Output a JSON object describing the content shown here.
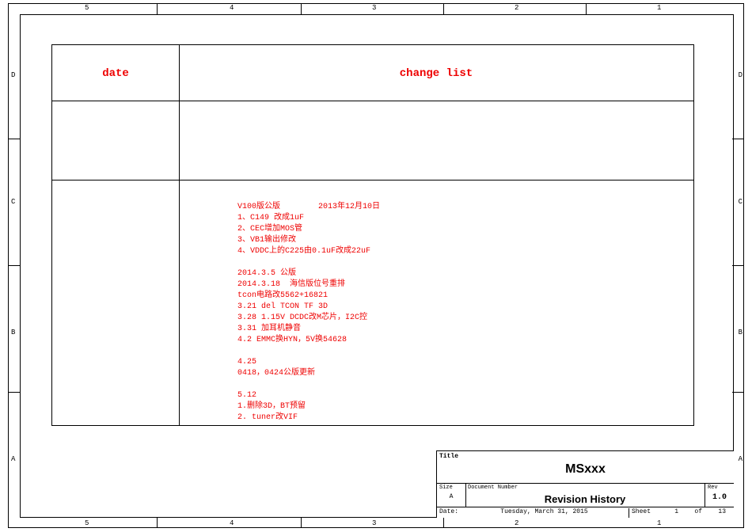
{
  "frame": {
    "top_numbers": [
      "5",
      "4",
      "3",
      "2",
      "1"
    ],
    "bottom_numbers": [
      "5",
      "4",
      "3",
      "2",
      "1"
    ],
    "left_letters": [
      "D",
      "C",
      "B",
      "A"
    ],
    "right_letters": [
      "D",
      "C",
      "B",
      "A"
    ]
  },
  "rev_table": {
    "header_date": "date",
    "header_change": "change list"
  },
  "notes": {
    "block1_header": "V100版公版        2013年12月10日",
    "block1_l1": "1、C149 改成1uF",
    "block1_l2": "2、CEC增加MOS管",
    "block1_l3": "3、VB1输出修改",
    "block1_l4": "4、VDDC上的C225由0.1uF改成22uF",
    "block2_l1": "2014.3.5 公版",
    "block2_l2": "2014.3.18  海信版位号重排",
    "block2_l3": "tcon电路改5562+16821",
    "block2_l4": "3.21 del TCON TF 3D",
    "block2_l5": "3.28 1.15V DCDC改M芯片，I2C控",
    "block2_l6": "3.31 加耳机静音",
    "block2_l7": "4.2 EMMC换HYN，5V换54628",
    "block3_l1": "4.25",
    "block3_l2": "0418，0424公版更新",
    "block4_l1": "5.12",
    "block4_l2": "1.删除3D，BT预留",
    "block4_l3": "2. tuner改VIF"
  },
  "titleblock": {
    "title_label": "Title",
    "title": "MSxxx",
    "size_label": "Size",
    "size": "A",
    "docnum_label": "Document Number",
    "docnum": "Revision History",
    "rev_label": "Rev",
    "rev": "1.0",
    "date_label": "Date:",
    "date": "Tuesday, March 31, 2015",
    "sheet_label": "Sheet",
    "sheet_n": "1",
    "sheet_of": "of",
    "sheet_total": "13"
  }
}
